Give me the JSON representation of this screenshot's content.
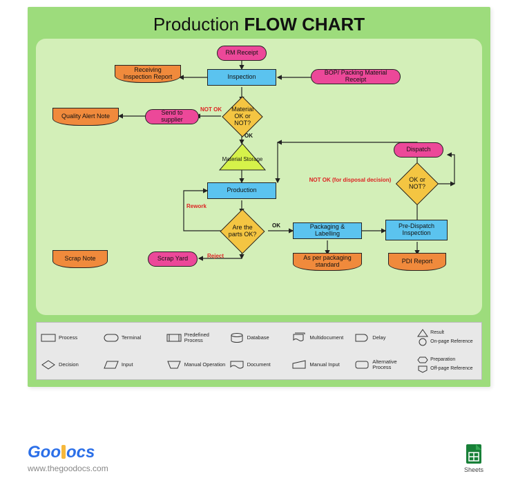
{
  "title": {
    "w1": "Production",
    "w2": "FLOW CHART"
  },
  "nodes": {
    "rm_receipt": "RM Receipt",
    "inspection": "Inspection",
    "bop": "BOP/ Packing Material Receipt",
    "receiving_report": "Receiving Inspection Report",
    "quality_alert": "Quality Alert Note",
    "send_supplier": "Send to supplier",
    "material_ok": "Material OK or NOT?",
    "material_storage": "Material Storage",
    "production": "Production",
    "are_parts_ok": "Are the parts OK?",
    "packaging": "Packaging & Labelling",
    "pre_dispatch": "Pre-Dispatch Inspection",
    "ok_or_not": "OK or NOT?",
    "dispatch": "Dispatch",
    "scrap_note": "Scrap Note",
    "scrap_yard": "Scrap Yard",
    "as_per_pkg": "As per packaging standard",
    "pdi_report": "PDI Report"
  },
  "labels": {
    "not_ok": "NOT OK",
    "ok": "OK",
    "rework": "Rework",
    "reject": "Reject",
    "not_ok_disposal": "NOT OK (for disposal decision)"
  },
  "legend": [
    "Process",
    "Terminal",
    "Predefined Process",
    "Database",
    "Multidocument",
    "Delay",
    "Result",
    "Circle",
    "On-page Reference",
    "Decision",
    "Input",
    "Manual Operation",
    "Document",
    "Manual Input",
    "Alternative Process",
    "Preparation",
    "Off-page Reference"
  ],
  "legend_items": {
    "r1c1": "Process",
    "r1c2": "Terminal",
    "r1c3": "Predefined Process",
    "r1c4": "Database",
    "r1c5": "Multidocument",
    "r1c6": "Delay",
    "r1c7a": "Result",
    "r1c7b": "On-page Reference",
    "r2c1": "Decision",
    "r2c2": "Input",
    "r2c3": "Manual Operation",
    "r2c4": "Document",
    "r2c5": "Manual Input",
    "r2c6": "Alternative Process",
    "r2c7a": "Preparation",
    "r2c7b": "Off-page Reference"
  },
  "footer": {
    "brand1": "Goo",
    "brand2": "ocs",
    "url": "www.thegoodocs.com",
    "sheets": "Sheets"
  },
  "colors": {
    "bg_outer": "#9ddc7c",
    "bg_inner": "#d3efb8",
    "pink": "#ec4899",
    "blue": "#5bc3ef",
    "orange": "#f08a3c",
    "yellow": "#f4c542",
    "lime": "#d6f24a",
    "red": "#d22"
  }
}
